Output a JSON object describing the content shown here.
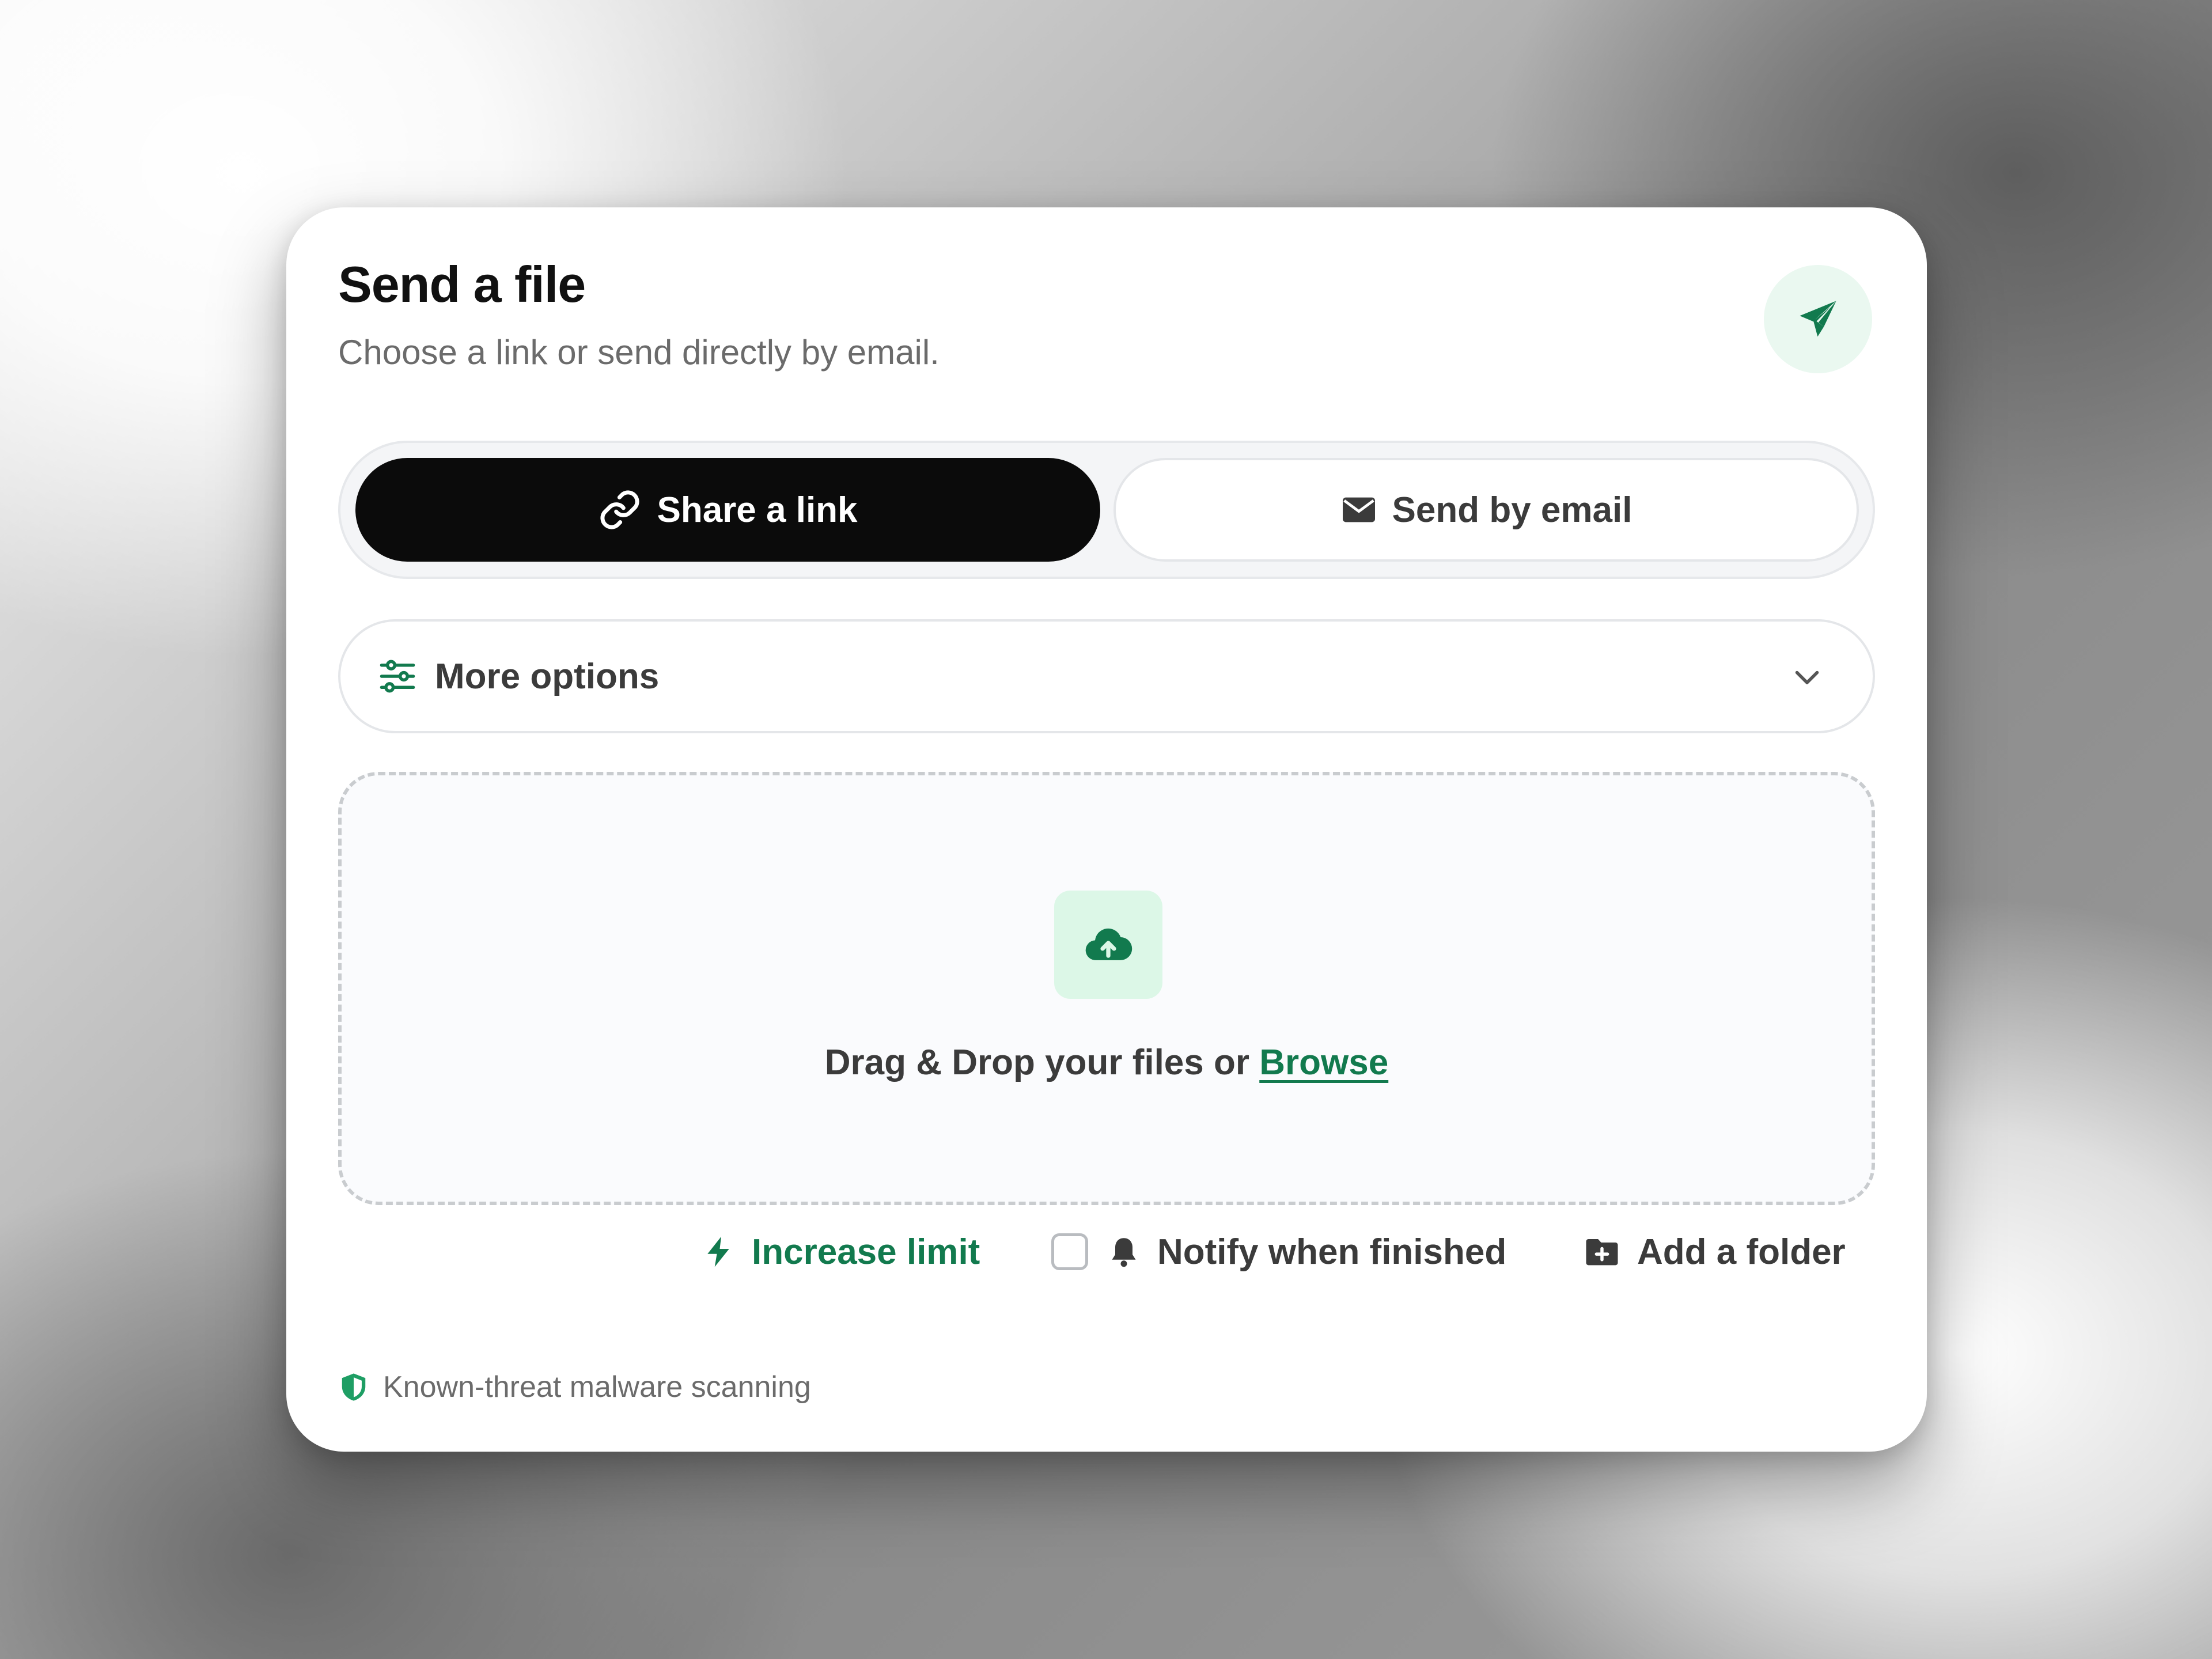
{
  "card": {
    "title": "Send a file",
    "subtitle": "Choose a link or send directly by email.",
    "badge_icon": "paper-plane-icon"
  },
  "tabs": [
    {
      "label": "Share a link",
      "icon": "link-icon",
      "selected": true
    },
    {
      "label": "Send by email",
      "icon": "envelope-icon",
      "selected": false
    }
  ],
  "more_options": {
    "label": "More options",
    "icon": "sliders-icon",
    "expanded": false
  },
  "dropzone": {
    "icon": "cloud-upload-icon",
    "text": "Drag & Drop your files or",
    "browse_label": "Browse"
  },
  "actions": {
    "increase_limit": "Increase limit",
    "notify_label": "Notify when finished",
    "notify_checked": false,
    "add_folder": "Add a folder"
  },
  "footer": {
    "security_text": "Known-threat malware scanning",
    "icon": "shield-icon"
  },
  "colors": {
    "accent_green": "#127a4e",
    "badge_bg": "#eaf8f0",
    "upload_tile_bg": "#dcf7e7",
    "primary_button_bg": "#0b0b0b"
  }
}
